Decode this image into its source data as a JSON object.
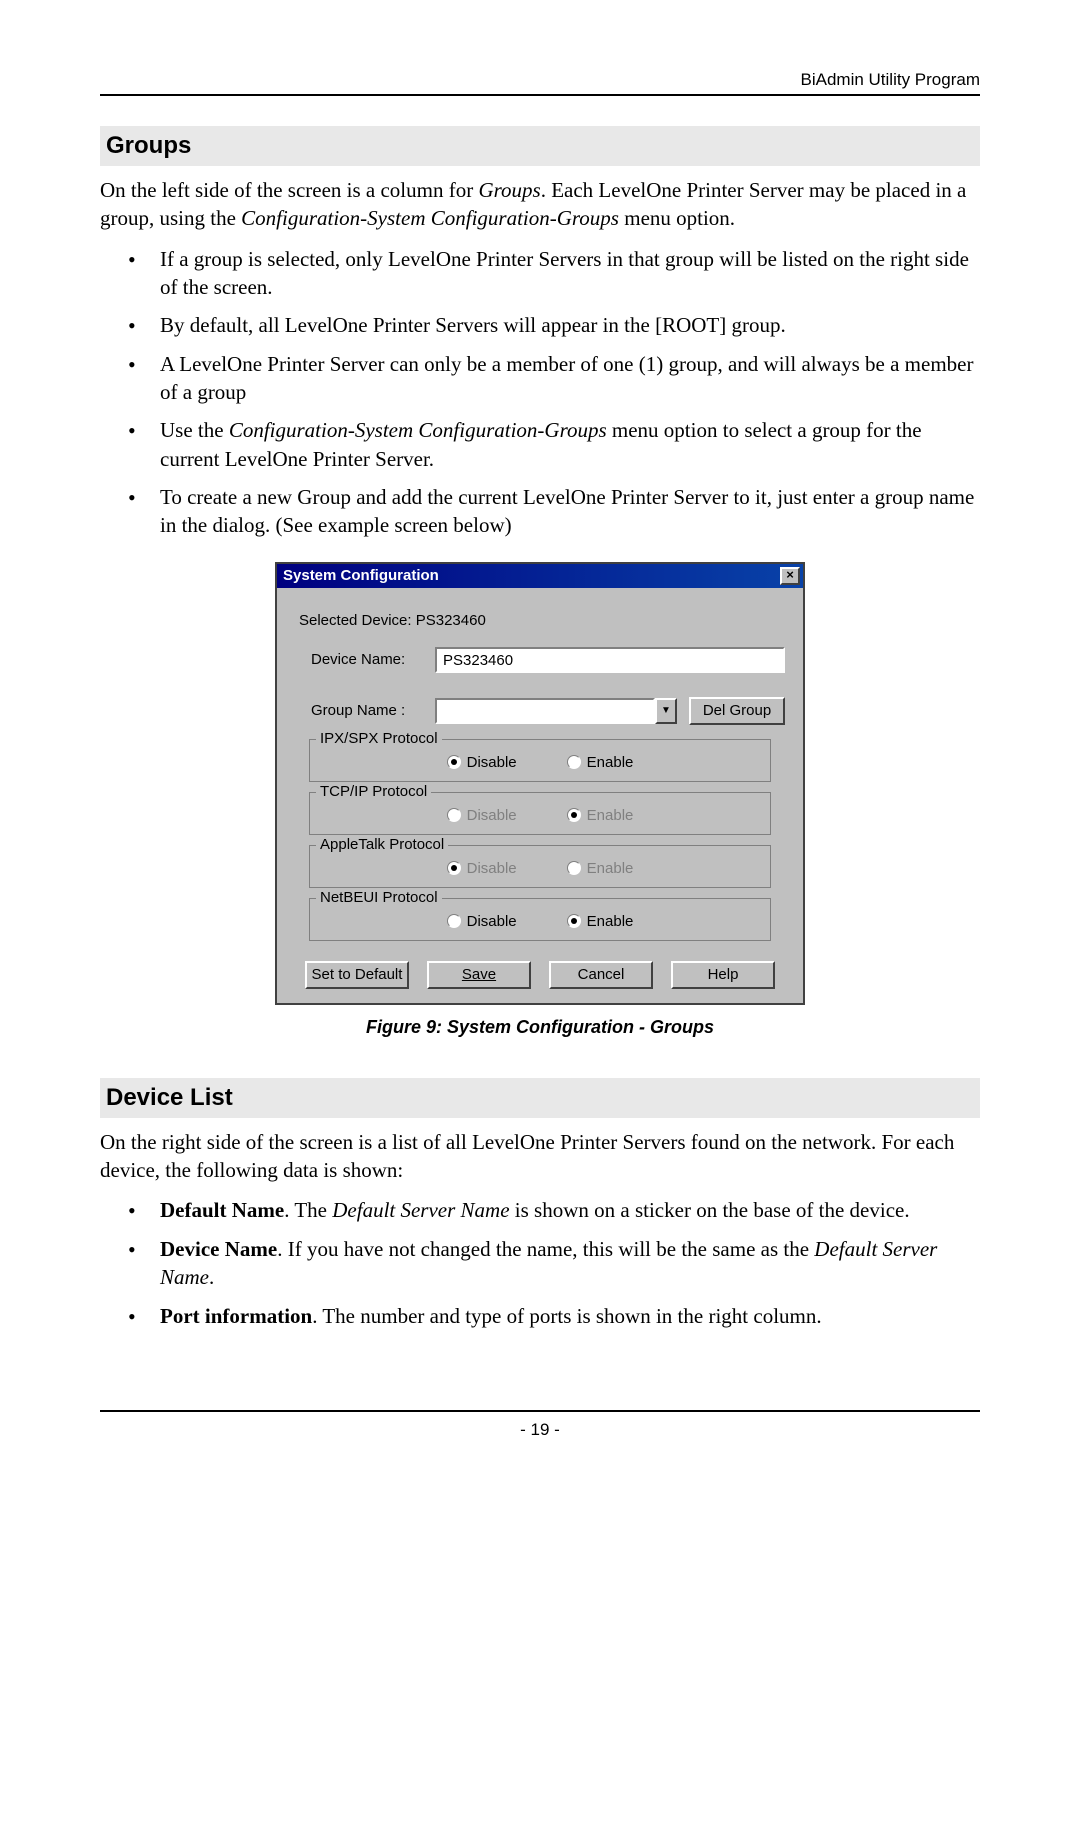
{
  "header": {
    "right": "BiAdmin Utility Program"
  },
  "footer": {
    "page": "- 19 -"
  },
  "section1": {
    "heading": "Groups",
    "para": "On the left side of the screen is a column for ",
    "para_italic": "Groups",
    "para_tail": ". Each LevelOne Printer Server may be placed in a group, using the ",
    "para_italic2": "Configuration-System Configuration-Groups",
    "para_tail2": " menu option.",
    "b1": "If a group is selected, only LevelOne Printer Servers in that group will be listed on the right side of the screen.",
    "b2": "By default, all LevelOne Printer Servers will appear in the [ROOT] group.",
    "b3": "A LevelOne Printer Server can only be a member of one (1) group, and will always be a member of a group",
    "b4_a": "Use the ",
    "b4_i": "Configuration-System Configuration-Groups",
    "b4_b": " menu option to select a group for the current LevelOne Printer Server.",
    "b5": "To create a new Group and add the current LevelOne Printer Server to it, just enter a group name in the dialog. (See example screen below)"
  },
  "dialog": {
    "title": "System Configuration",
    "close": "×",
    "selected_label": "Selected Device: ",
    "selected_value": "PS323460",
    "device_name_label": "Device Name:",
    "device_name_value": "PS323460",
    "group_name_label": "Group Name :",
    "group_name_value": "",
    "del_group": "Del Group",
    "proto1": {
      "legend": "IPX/SPX Protocol",
      "disable": "Disable",
      "enable": "Enable",
      "selected": "disable",
      "disabled": false
    },
    "proto2": {
      "legend": "TCP/IP Protocol",
      "disable": "Disable",
      "enable": "Enable",
      "selected": "enable",
      "disabled": true
    },
    "proto3": {
      "legend": "AppleTalk Protocol",
      "disable": "Disable",
      "enable": "Enable",
      "selected": "disable",
      "disabled": true
    },
    "proto4": {
      "legend": "NetBEUI Protocol",
      "disable": "Disable",
      "enable": "Enable",
      "selected": "enable",
      "disabled": false
    },
    "btn_default": "Set to Default",
    "btn_save": "Save",
    "btn_cancel": "Cancel",
    "btn_help": "Help"
  },
  "caption": "Figure 9: System Configuration - Groups",
  "section2": {
    "heading": "Device List",
    "para": "On the right side of the screen is a list of all LevelOne Printer Servers found on the network. For each device, the following data is shown:",
    "b1_bold": "Default Name",
    "b1_a": ". The ",
    "b1_i": "Default Server Name",
    "b1_b": " is shown on a sticker on the base of the device.",
    "b2_bold": "Device Name",
    "b2_a": ". If you have not changed the name, this will be the same as the ",
    "b2_i": "Default Server Name",
    "b2_b": ".",
    "b3_bold": "Port information",
    "b3_a": ". The number and type of ports is shown in the right column."
  }
}
